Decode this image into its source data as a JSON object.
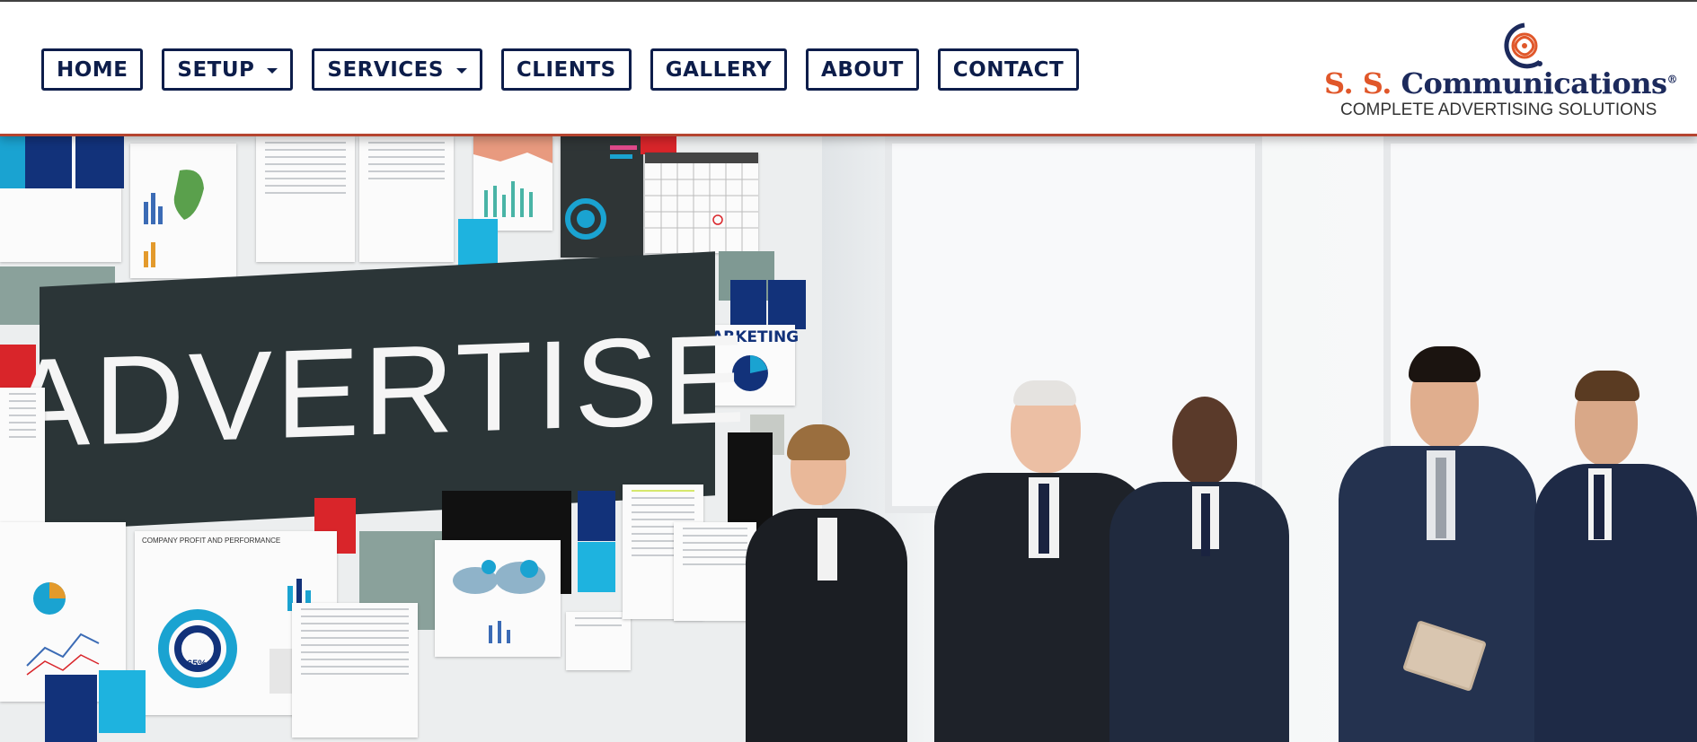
{
  "nav": {
    "items": [
      {
        "label": "HOME",
        "dropdown": false
      },
      {
        "label": "SETUP",
        "dropdown": true
      },
      {
        "label": "SERVICES",
        "dropdown": true
      },
      {
        "label": "CLIENTS",
        "dropdown": false
      },
      {
        "label": "GALLERY",
        "dropdown": false
      },
      {
        "label": "ABOUT",
        "dropdown": false
      },
      {
        "label": "CONTACT",
        "dropdown": false
      }
    ]
  },
  "logo": {
    "initials": "S. S.",
    "name": "Communications",
    "registered": "®",
    "tagline": "COMPLETE ADVERTISING SOLUTIONS"
  },
  "hero": {
    "banner_text": "ADVERTISE",
    "marketing_text": "ARKETING",
    "company_profile_text": "COMPANY PROFIT AND PERFORMANCE",
    "percent_text": "65%"
  },
  "colors": {
    "nav_border": "#0d1d4a",
    "accent": "#e0572a",
    "header_rule": "#b5442f"
  }
}
